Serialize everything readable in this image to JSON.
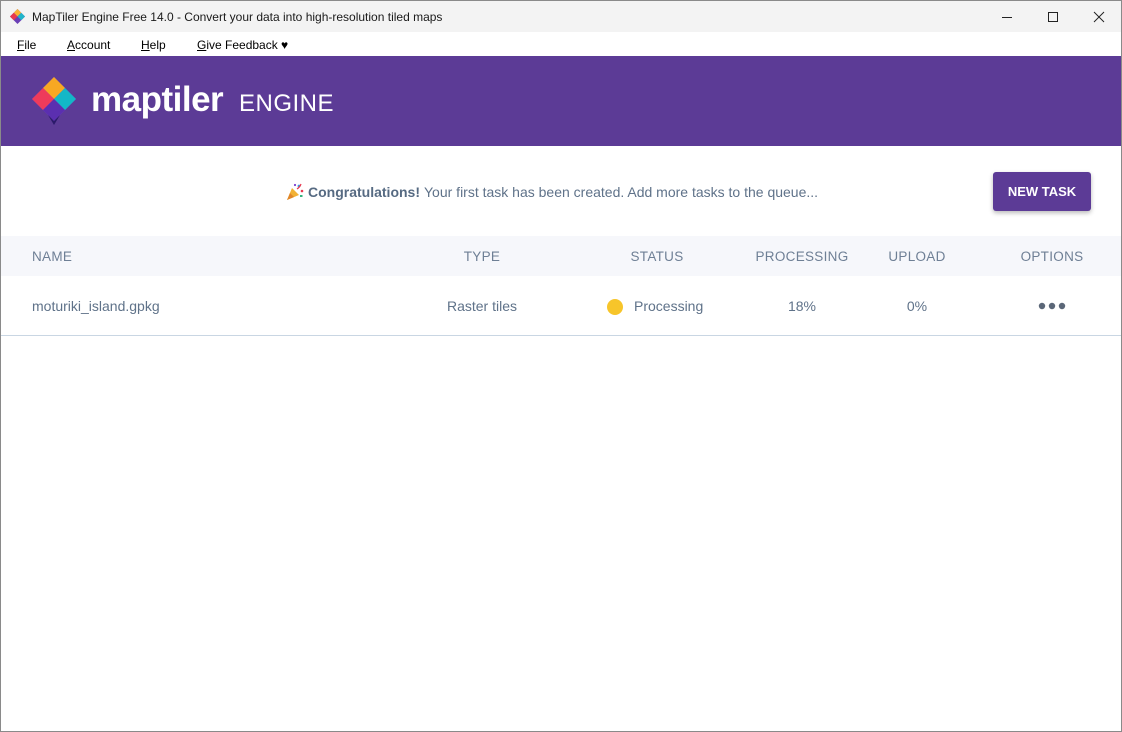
{
  "window": {
    "title": "MapTiler Engine Free 14.0 - Convert your data into high-resolution tiled maps",
    "controls": [
      "minimize-icon",
      "maximize-icon",
      "close-icon"
    ]
  },
  "menu": {
    "file": {
      "first": "F",
      "rest": "ile"
    },
    "account": {
      "first": "A",
      "rest": "ccount"
    },
    "help": {
      "first": "H",
      "rest": "elp"
    },
    "feedback": {
      "first": "G",
      "rest": "ive Feedback ♥"
    }
  },
  "header": {
    "brand": "maptiler",
    "product": "ENGINE",
    "background": "#5c3b96"
  },
  "banner": {
    "emoji_icon": "party-popper-icon",
    "headline": "Congratulations!",
    "message": "Your first task has been created. Add more tasks to the queue...",
    "new_task_label": "NEW TASK"
  },
  "table": {
    "columns": [
      "NAME",
      "TYPE",
      "STATUS",
      "PROCESSING",
      "UPLOAD",
      "OPTIONS"
    ],
    "rows": [
      {
        "name": "moturiki_island.gpkg",
        "type": "Raster tiles",
        "status": "Processing",
        "status_color": "#f7c52a",
        "processing": "18%",
        "upload": "0%",
        "options_icon": "more-horizontal-icon"
      }
    ]
  }
}
